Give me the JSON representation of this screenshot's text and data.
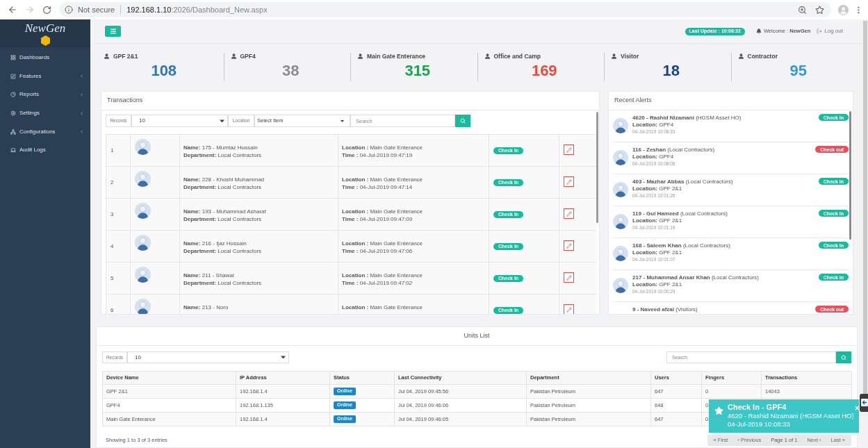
{
  "browser": {
    "security": "Not secure",
    "url_host": "192.168.1.10",
    "url_path": ":2026/Dashboard_New.aspx"
  },
  "sidebar": {
    "logo": "NewGen",
    "items": [
      {
        "label": "Dashboards",
        "has_submenu": false
      },
      {
        "label": "Features",
        "has_submenu": true
      },
      {
        "label": "Reports",
        "has_submenu": true
      },
      {
        "label": "Settings",
        "has_submenu": true
      },
      {
        "label": "Configurations",
        "has_submenu": true
      },
      {
        "label": "Audit Logs",
        "has_submenu": false
      }
    ]
  },
  "topbar": {
    "last_update": "Last Update : 10:08:32",
    "welcome": "Welcome : **NewGen**",
    "logout": "Log out"
  },
  "stats": [
    {
      "label": "GPF 2&1",
      "value": "108",
      "color": "#2a7ab8"
    },
    {
      "label": "GPF4",
      "value": "38",
      "color": "#8c8c8c"
    },
    {
      "label": "Main Gate Enterance",
      "value": "315",
      "color": "#1ba34e"
    },
    {
      "label": "Office and Camp",
      "value": "169",
      "color": "#e74c3c"
    },
    {
      "label": "Visitor",
      "value": "18",
      "color": "#1b3f8f"
    },
    {
      "label": "Contractor",
      "value": "95",
      "color": "#3498db"
    }
  ],
  "transactions": {
    "title": "Transactions",
    "records_label": "Records",
    "records_value": "10",
    "location_label": "Location",
    "location_value": "Select Item",
    "search_placeholder": "Search",
    "rows": [
      {
        "index": "1",
        "name": "**Name:** 175 - Mumtaz Hussain",
        "department": "**Department:** Local Contractors",
        "location": "**Location :** Main Gate Enterance",
        "time": "**Time :** 04-Jul-2019 09:47:19",
        "status": {
          "label": "Check In",
          "kind": "check_in"
        }
      },
      {
        "index": "2",
        "name": "**Name:** 228 - Khoshi Muhammad",
        "department": "**Department:** Local Contractors",
        "location": "**Location :** Main Gate Enterance",
        "time": "**Time :** 04-Jul-2019 09:47:14",
        "status": {
          "label": "Check In",
          "kind": "check_in"
        }
      },
      {
        "index": "3",
        "name": "**Name:** 193 - Muhammad Asharaf",
        "department": "**Department:** Local Contractors",
        "location": "**Location :** Main Gate Enterance",
        "time": "**Time :** 04-Jul-2019 09:47:09",
        "status": {
          "label": "Check In",
          "kind": "check_in"
        }
      },
      {
        "index": "4",
        "name": "**Name:** 216 - Ijaz Hussain",
        "department": "**Department:** Local Contractors",
        "location": "**Location :** Main Gate Enterance",
        "time": "**Time :** 04-Jul-2019 09:47:06",
        "status": {
          "label": "Check In",
          "kind": "check_in"
        }
      },
      {
        "index": "5",
        "name": "**Name:** 211 - Shawal",
        "department": "**Department:** Local Contractors",
        "location": "**Location :** Main Gate Enterance",
        "time": "**Time :** 04-Jul-2019 09:47:02",
        "status": {
          "label": "Check In",
          "kind": "check_in"
        }
      },
      {
        "index": "6",
        "name": "**Name:** 213 - Noro",
        "location": "**Location :** Main Gate Enterance",
        "status": {
          "label": "Check In",
          "kind": "check_in"
        }
      }
    ]
  },
  "recent_alerts": {
    "title": "Recent Alerts",
    "items": [
      {
        "person": "**4620 - Rashid Nizamani** (HGSM Asset HO)",
        "location": "**Location:** GPF4",
        "time": "04-Jul-2019 10:08:33",
        "status": {
          "label": "Check In",
          "kind": "check_in"
        }
      },
      {
        "person": "**116 - Zeshan** (Local Contractors)",
        "location": "**Location:** GPF4",
        "time": "04-Jul-2019 10:08:06",
        "status": {
          "label": "Check out",
          "kind": "check_out"
        }
      },
      {
        "person": "**403 - Mazhar Abbas** (Local Contractors)",
        "location": "**Location:** GPF 2&1",
        "time": "04-Jul-2019 10:01:26",
        "status": {
          "label": "Check In",
          "kind": "check_in"
        }
      },
      {
        "person": "**119 - Gul Hameed** (Local Contractors)",
        "location": "**Location:** GPF 2&1",
        "time": "04-Jul-2019 10:01:19",
        "status": {
          "label": "Check In",
          "kind": "check_in"
        }
      },
      {
        "person": "**168 - Saleem Khan** (Local Contractors)",
        "location": "**Location:** GPF 2&1",
        "time": "04-Jul-2019 10:01:07",
        "status": {
          "label": "Check In",
          "kind": "check_in"
        }
      },
      {
        "person": "**217 - Muhammad Ansar Khan** (Local Contractors)",
        "location": "**Location:** GPF 2&1",
        "time": "04-Jul-2019 10:00:29",
        "status": {
          "label": "Check In",
          "kind": "check_in"
        }
      },
      {
        "person": "**9 - Naveed afzal** (Visitors)",
        "status": {
          "label": "Check out",
          "kind": "check_out"
        }
      }
    ]
  },
  "units_list": {
    "title": "Units List",
    "records_label": "Records",
    "records_value": "10",
    "search_placeholder": "Search",
    "columns": [
      "Device Name",
      "IP Address",
      "Status",
      "Last Connectivity",
      "Department",
      "Users",
      "Fingers",
      "Transactions"
    ],
    "rows": [
      {
        "device": "GPF 2&1",
        "ip": "192.168.1.4",
        "status": {
          "label": "Online",
          "kind": "online"
        },
        "last_connectivity": "Jul 04, 2019 09:45:56",
        "department": "Pakistan Petroleum",
        "users": "647",
        "fingers": "0",
        "transactions": "14043"
      },
      {
        "device": "GPF4",
        "ip": "192.168.1.135",
        "status": {
          "label": "Online",
          "kind": "online"
        },
        "last_connectivity": "Jul 04, 2019 09:46:06",
        "department": "Pakistan Petroleum",
        "users": "648",
        "fingers": "0"
      },
      {
        "device": "Main Gate Enterance",
        "ip": "192.168.1.4",
        "status": {
          "label": "Online",
          "kind": "online"
        },
        "last_connectivity": "Jul 04, 2019 09:46:05",
        "department": "Pakistan Petroleum",
        "users": "647",
        "fingers": "0"
      }
    ],
    "summary": "Showing 1 to 3 of 3 entries",
    "pagination": [
      {
        "label": "« First",
        "kind": "button"
      },
      {
        "label": "‹ Previous",
        "kind": "button"
      },
      {
        "label": "Page 1 of 1",
        "kind": "indicator"
      },
      {
        "label": "Next ›",
        "kind": "button"
      },
      {
        "label": "Last »",
        "kind": "button"
      }
    ]
  },
  "toast": {
    "title": "Check In - GPF4",
    "message": "4620 - Rashid Nizamani (HGSM Asset HO)",
    "time": "04-Jul-2019 10:08:33"
  }
}
